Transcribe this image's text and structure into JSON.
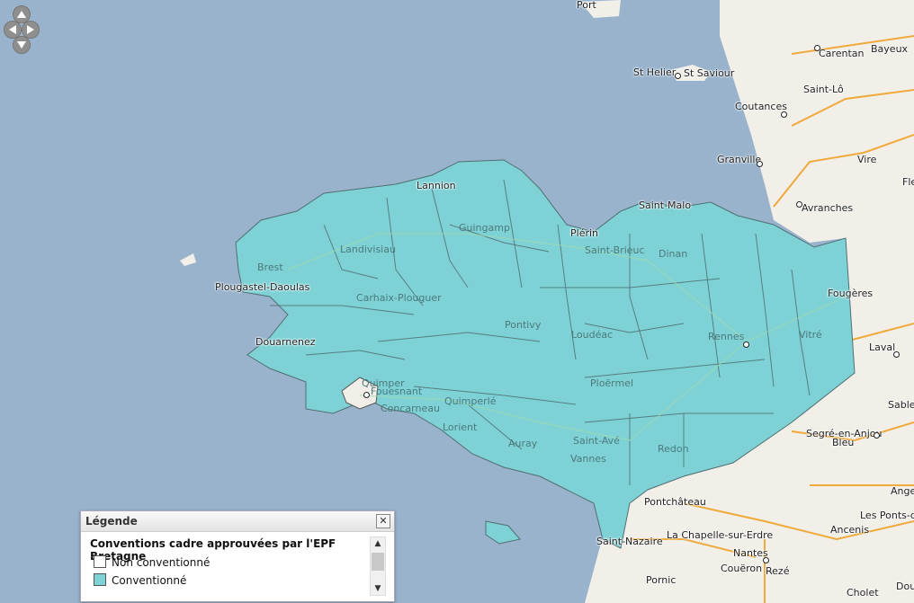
{
  "map": {
    "colors": {
      "sea": "#99b3cc",
      "land": "#f2efe9",
      "conventionne": "#7ed2d6",
      "non_conventionne": "#ffffff",
      "roads": "#f0a93b"
    },
    "places": {
      "port": "Port",
      "st_helier": "St Helier",
      "st_saviour": "St Saviour",
      "carentan": "Carentan",
      "bayeux": "Bayeux",
      "saint_lo": "Saint-Lô",
      "coutances": "Coutances",
      "granville": "Granville",
      "vire": "Vire",
      "fle": "Fle",
      "avranches": "Avranches",
      "saint_malo": "Saint-Malo",
      "lannion": "Lannion",
      "guingamp": "Guingamp",
      "plerin": "Plérin",
      "saint_brieuc": "Saint-Brieuc",
      "dinan": "Dinan",
      "landivisiau": "Landivisiau",
      "brest": "Brest",
      "plougastel": "Plougastel-Daoulas",
      "fougeres": "Fougères",
      "carhaix": "Carhaix-Plouguer",
      "douarnenez": "Douarnenez",
      "rennes": "Rennes",
      "vitre": "Vitré",
      "laval": "Laval",
      "loudeac": "Loudéac",
      "pontivy": "Pontivy",
      "quimper": "Quimper",
      "fouesnant": "Fouesnant",
      "concarneau": "Concarneau",
      "quimperle": "Quimperlé",
      "ploermel": "Ploërmel",
      "sable": "Sable",
      "lorient": "Lorient",
      "segre": "Segré-en-Anjou",
      "bleu": "Bleu",
      "auray": "Auray",
      "saint_ave": "Saint-Avé",
      "vannes": "Vannes",
      "redon": "Redon",
      "angers": "Angers",
      "pontchateau": "Pontchâteau",
      "les_ponts": "Les Ponts-de-",
      "ancenis": "Ancenis",
      "saint_nazaire": "Saint-Nazaire",
      "la_chapelle": "La Chapelle-sur-Erdre",
      "nantes": "Nantes",
      "coueron": "Couëron",
      "reze": "Rezé",
      "pornic": "Pornic",
      "cholet": "Cholet",
      "dou": "Dou"
    }
  },
  "controls": {
    "pan_up": "pan-up-icon",
    "pan_left": "pan-left-icon",
    "pan_right": "pan-right-icon",
    "pan_down": "pan-down-icon"
  },
  "legend": {
    "header": "Légende",
    "close_label": "✕",
    "title": "Conventions cadre approuvées par l'EPF Bretagne",
    "items": [
      {
        "label": "Non conventionné",
        "color": "#ffffff"
      },
      {
        "label": "Conventionné",
        "color": "#7ed2d6"
      }
    ]
  }
}
